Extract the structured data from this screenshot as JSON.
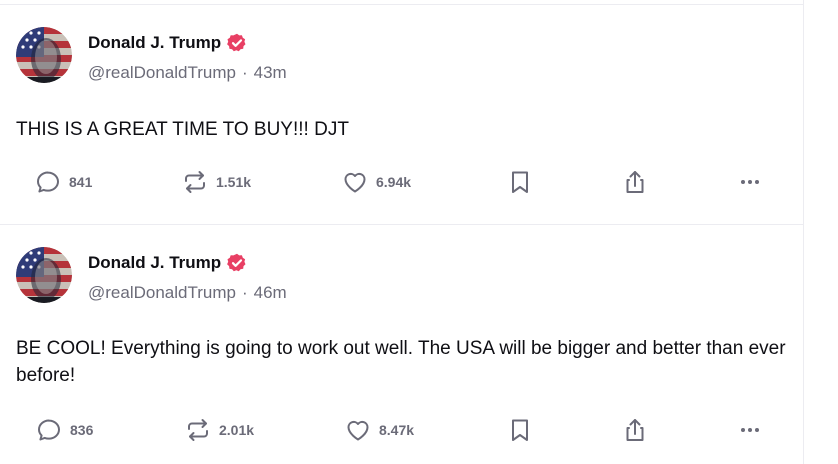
{
  "colors": {
    "verified_badge": "#e83f64",
    "muted_text": "#6b6b78",
    "divider": "#ececf1"
  },
  "posts": [
    {
      "author": {
        "name": "Donald J. Trump",
        "handle": "@realDonaldTrump",
        "verified_icon": "verified-badge-icon"
      },
      "time": "43m",
      "separator": "·",
      "text": "THIS IS A GREAT TIME TO BUY!!! DJT",
      "actions": {
        "replies": "841",
        "retruths": "1.51k",
        "likes": "6.94k"
      }
    },
    {
      "author": {
        "name": "Donald J. Trump",
        "handle": "@realDonaldTrump",
        "verified_icon": "verified-badge-icon"
      },
      "time": "46m",
      "separator": "·",
      "text": "BE COOL! Everything is going to work out well. The USA will be bigger and better than ever before!",
      "actions": {
        "replies": "836",
        "retruths": "2.01k",
        "likes": "8.47k"
      }
    }
  ]
}
